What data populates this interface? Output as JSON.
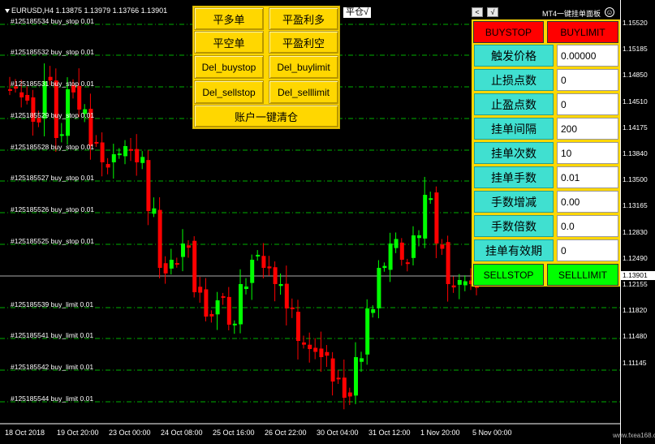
{
  "chart": {
    "symbol_info": "EURUSD,H4  1.13875 1.13979 1.13766 1.13901",
    "current_price": "1.13901",
    "price_labels": [
      "1.15520",
      "1.15185",
      "1.14850",
      "1.14510",
      "1.14175",
      "1.13840",
      "1.13500",
      "1.13165",
      "1.12830",
      "1.12490",
      "1.12155",
      "1.11820",
      "1.11480",
      "1.11145"
    ],
    "price_ticks": [
      "1.15520",
      "1.15185",
      "1.14850",
      "1.14510",
      "1.14180",
      "1.13840",
      "1.13500",
      "1.13165",
      "1.12830",
      "1.12490",
      "1.12155",
      "1.11820",
      "1.11480",
      "1.11145"
    ],
    "time_labels": [
      "18 Oct 2018",
      "19 Oct 20:00",
      "23 Oct 00:00",
      "24 Oct 08:00",
      "25 Oct 16:00",
      "26 Oct 22:00",
      "30 Oct 04:00",
      "31 Oct 12:00",
      "1 Nov 20:00",
      "5 Nov 00:00"
    ]
  },
  "price_axis": [
    "1.15520",
    "1.15185",
    "1.14850",
    "1.14510",
    "1.14180",
    "1.13840",
    "1.13500",
    "1.13165",
    "1.12830",
    "1.12490"
  ],
  "axis": {
    "prices": [
      "1.15520",
      "1.15185",
      "1.14850",
      "1.14510",
      "1.14180",
      "1.13840",
      "1.13500",
      "1.13165",
      "1.12830",
      "1.12490",
      "1.12155",
      "1.11820",
      "1.11480",
      "1.11145"
    ]
  },
  "orders": [
    {
      "label": "#125185534 buy_stop 0.01"
    },
    {
      "label": "#125185532 buy_stop 0.01"
    },
    {
      "label": "#125185531 buy_stop 0.01"
    },
    {
      "label": "#125185529 buy_stop 0.01"
    },
    {
      "label": "#125185528 buy_stop 0.01"
    },
    {
      "label": "#125185527 buy_stop 0.01"
    },
    {
      "label": "#125185526 buy_stop 0.01"
    },
    {
      "label": "#125185525 buy_stop 0.01"
    },
    {
      "label": "#125185539 buy_limit 0.01"
    },
    {
      "label": "#125185541 buy_limit 0.01"
    },
    {
      "label": "#125185542 buy_limit 0.01"
    },
    {
      "label": "#125185544 buy_limit 0.01"
    }
  ],
  "buttons": {
    "close_long": "平多单",
    "close_profit_long": "平盈利多",
    "close_short": "平空单",
    "close_profit_short": "平盈利空",
    "del_buystop": "Del_buystop",
    "del_buylimit": "Del_buylimit",
    "del_sellstop": "Del_sellstop",
    "del_selllimit": "Del_selllimit",
    "close_all": "账户一键清仓"
  },
  "pingcang": "平仓√",
  "right_panel": {
    "title": "MT4一键挂单面板",
    "arrow_left": "<",
    "check": "√",
    "smile": "☺",
    "buystop": "BUYSTOP",
    "buylimit": "BUYLIMIT",
    "sellstop": "SELLSTOP",
    "selllimit": "SELLLIMIT",
    "fields": [
      {
        "label": "触发价格",
        "value": "0.00000"
      },
      {
        "label": "止损点数",
        "value": "0"
      },
      {
        "label": "止盈点数",
        "value": "0"
      },
      {
        "label": "挂单间隔",
        "value": "200"
      },
      {
        "label": "挂单次数",
        "value": "10"
      },
      {
        "label": "挂单手数",
        "value": "0.01"
      },
      {
        "label": "手数增减",
        "value": "0.00"
      },
      {
        "label": "手数倍数",
        "value": "0.0"
      },
      {
        "label": "挂单有效期",
        "value": "0"
      }
    ]
  },
  "price_scale": [
    "1.15520",
    "1.15185",
    "1.14850",
    "1.14510",
    "1.14175",
    "1.13840",
    "1.13500",
    "1.13165",
    "1.12830",
    "1.12490",
    "1.12155",
    "1.11820",
    "1.11480",
    "1.11145"
  ],
  "scale": [
    "1.15520",
    "1.15185",
    "1.14850",
    "1.14510",
    "1.14175",
    "1.13840",
    "1.13500",
    "1.13165",
    "1.12830",
    "1.12490",
    "1.12155",
    "1.11820",
    "1.11480",
    "1.11145"
  ],
  "watermark": "www.fxea168.com",
  "colors": {
    "bull": "#00ff00",
    "bear": "#ff0000",
    "panel": "#ffd700",
    "label_bg": "#40e0d0",
    "order_line": "#00c000"
  }
}
